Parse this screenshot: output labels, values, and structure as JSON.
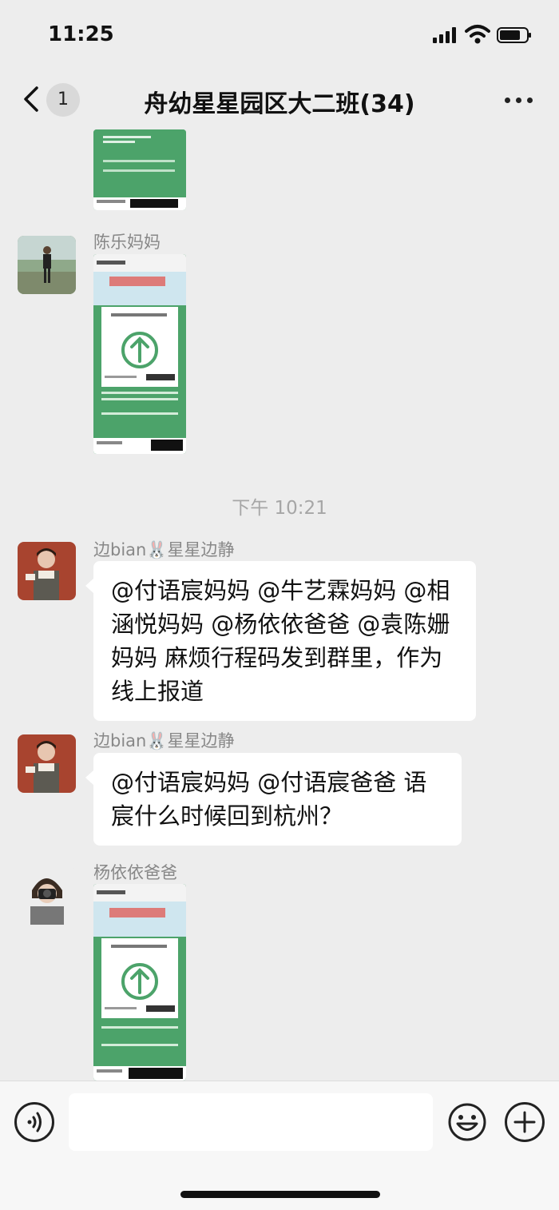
{
  "status": {
    "time": "11:25"
  },
  "nav": {
    "unread_count": "1",
    "title": "舟幼星星园区大二班(34)"
  },
  "messages": [
    {
      "type": "image",
      "sender": "",
      "avatar": ""
    },
    {
      "type": "image",
      "sender": "陈乐妈妈",
      "avatar": "person-outdoor-photo"
    },
    {
      "type": "time",
      "text": "下午 10:21"
    },
    {
      "type": "text",
      "sender": "边bian🐰星星边静",
      "text": "@付语宸妈妈 @牛艺霖妈妈 @相涵悦妈妈 @杨依依爸爸 @袁陈姗妈妈 麻烦行程码发到群里，作为线上报道"
    },
    {
      "type": "text",
      "sender": "边bian🐰星星边静",
      "text": "@付语宸妈妈 @付语宸爸爸 语宸什么时候回到杭州？"
    },
    {
      "type": "image",
      "sender": "杨依依爸爸",
      "avatar": "person-camera-photo"
    }
  ],
  "colors": {
    "accent_green": "#4ca36a",
    "background": "#ededed",
    "bubble": "#ffffff"
  },
  "icons": [
    "back-chevron-icon",
    "more-dots-icon",
    "voice-icon",
    "emoji-icon",
    "plus-icon",
    "green-arrow-up-icon"
  ]
}
